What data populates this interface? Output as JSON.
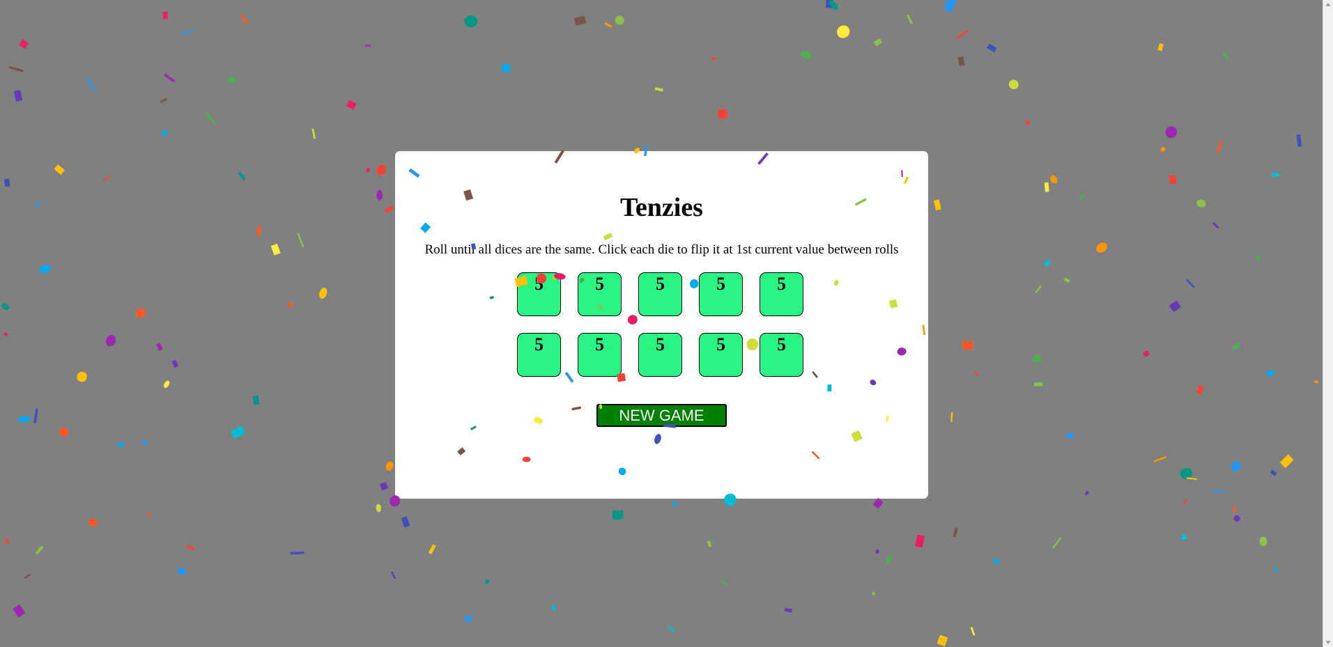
{
  "game": {
    "title": "Tenzies",
    "instructions": "Roll until all dices are the same. Click each die to flip it at 1st current value between rolls",
    "dice": [
      {
        "value": "5"
      },
      {
        "value": "5"
      },
      {
        "value": "5"
      },
      {
        "value": "5"
      },
      {
        "value": "5"
      },
      {
        "value": "5"
      },
      {
        "value": "5"
      },
      {
        "value": "5"
      },
      {
        "value": "5"
      },
      {
        "value": "5"
      }
    ],
    "button_label": "NEW GAME"
  },
  "colors": {
    "background": "#808080",
    "card": "#ffffff",
    "die_fill": "#29f583",
    "button_fill": "#008000",
    "button_text": "#ffffff"
  },
  "effects": {
    "confetti": true,
    "confetti_palette": [
      "#f44336",
      "#e91e63",
      "#9c27b0",
      "#673ab7",
      "#3f51b5",
      "#2196f3",
      "#03a9f4",
      "#00bcd4",
      "#009688",
      "#4caf50",
      "#8bc34a",
      "#cddc39",
      "#ffeb3b",
      "#ffc107",
      "#ff9800",
      "#ff5722",
      "#795548"
    ]
  }
}
